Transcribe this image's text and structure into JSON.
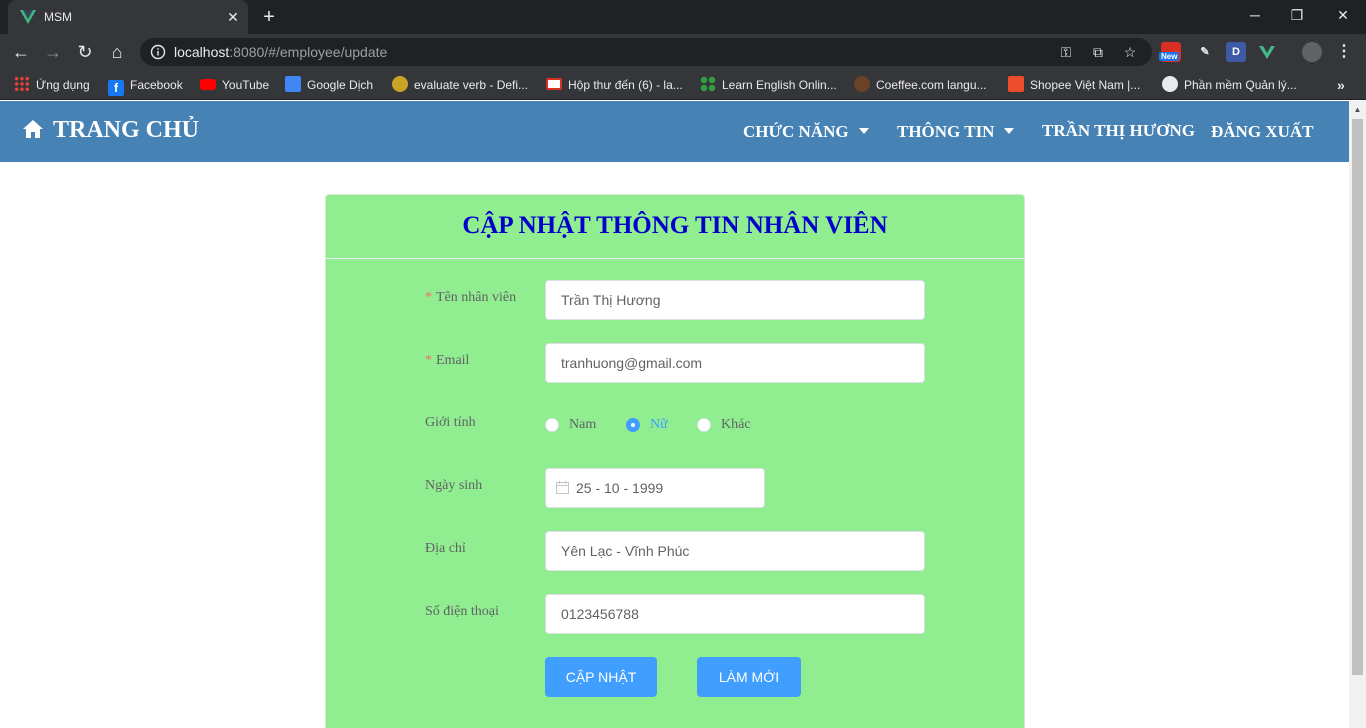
{
  "browser": {
    "tab_title": "MSM",
    "url_host": "localhost",
    "url_rest": ":8080/#/employee/update",
    "bookmarks": [
      {
        "label": "Ứng dụng",
        "icon": "apps-grid-icon",
        "color": "#ea4335"
      },
      {
        "label": "Facebook",
        "icon": "facebook-icon",
        "color": "#1877f2"
      },
      {
        "label": "YouTube",
        "icon": "youtube-icon",
        "color": "#ff0000"
      },
      {
        "label": "Google Dịch",
        "icon": "google-translate-icon",
        "color": "#4285f4"
      },
      {
        "label": "evaluate verb - Defi...",
        "icon": "dictionary-icon",
        "color": "#c9a227"
      },
      {
        "label": "Hộp thư đến (6) - la...",
        "icon": "gmail-icon",
        "color": "#d93025"
      },
      {
        "label": "Learn English Onlin...",
        "icon": "clover-icon",
        "color": "#2e9e3e"
      },
      {
        "label": "Coeffee.com langu...",
        "icon": "coeffee-icon",
        "color": "#6b4226"
      },
      {
        "label": "Shopee Việt Nam |...",
        "icon": "shopee-icon",
        "color": "#ee4d2d"
      },
      {
        "label": "Phần mềm Quản lý...",
        "icon": "globe-icon",
        "color": "#e8eaed"
      }
    ],
    "new_badge": "New",
    "ext_d_label": "D"
  },
  "header": {
    "brand": "TRANG CHỦ",
    "menu": {
      "features": "CHỨC NĂNG",
      "info": "THÔNG TIN",
      "user": "TRẦN THỊ HƯƠNG",
      "logout": "ĐĂNG XUẤT"
    },
    "bg_color": "#4682b4"
  },
  "form": {
    "title": "CẬP NHẬT THÔNG TIN NHÂN VIÊN",
    "required_mark": "*",
    "fields": {
      "name_label": "Tên nhân viên",
      "name_value": "Trần Thị Hương",
      "email_label": "Email",
      "email_value": "tranhuong@gmail.com",
      "gender_label": "Giới tính",
      "gender_options": [
        "Nam",
        "Nữ",
        "Khác"
      ],
      "gender_selected": "Nữ",
      "dob_label": "Ngày sinh",
      "dob_value": "25 - 10 - 1999",
      "address_label": "Địa chỉ",
      "address_value": "Yên Lạc - Vĩnh Phúc",
      "phone_label": "Số điện thoại",
      "phone_value": "0123456788"
    },
    "buttons": {
      "update": "CẬP NHẬT",
      "reset": "LÀM MỚI"
    },
    "card_color": "#90ee90",
    "title_color": "#0000cd",
    "accent_color": "#409eff"
  }
}
